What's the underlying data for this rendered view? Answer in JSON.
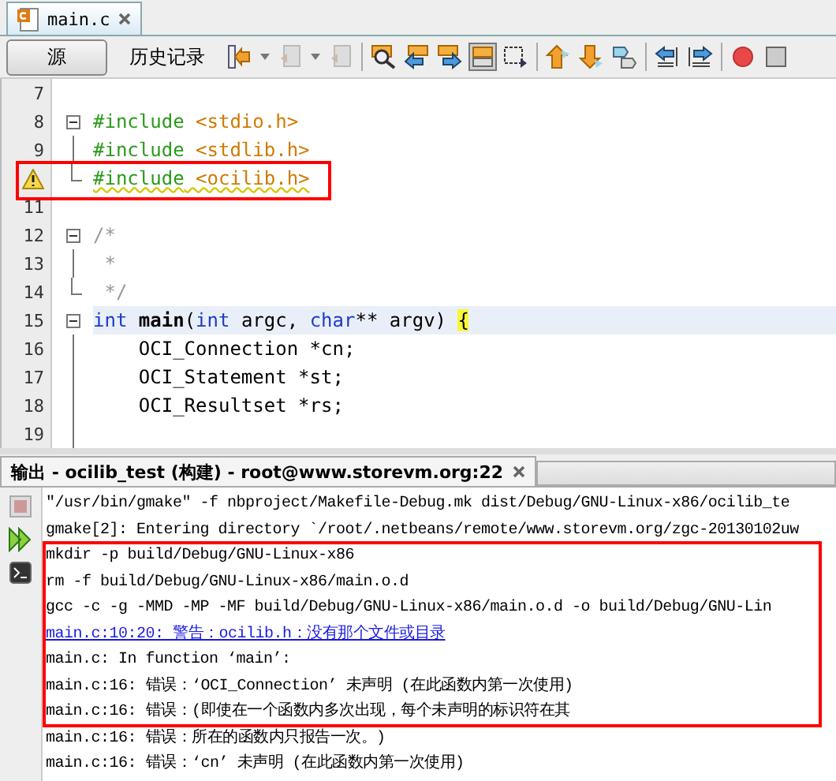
{
  "editor_tab": {
    "title": "main.c"
  },
  "view_tabs": [
    {
      "label": "源",
      "selected": true
    },
    {
      "label": "历史记录",
      "selected": false
    }
  ],
  "code_lines": [
    {
      "number": "7",
      "kind": "plain",
      "current": false
    },
    {
      "number": "8",
      "kind": "start",
      "current": false,
      "tokens": [
        {
          "kind": "directive",
          "text": "#include"
        },
        {
          "kind": "header",
          "text": " <stdio.h>"
        }
      ]
    },
    {
      "number": "9",
      "kind": "inside",
      "current": false,
      "tokens": [
        {
          "kind": "directive",
          "text": "#include"
        },
        {
          "kind": "header",
          "text": " <stdlib.h>"
        }
      ]
    },
    {
      "warning": true,
      "kind": "end",
      "current": false,
      "tokens": [
        {
          "kind": "directive",
          "text": "#include",
          "squiggle": true
        },
        {
          "kind": "header",
          "text": " <ocilib.h>",
          "squiggle": true
        }
      ]
    },
    {
      "number": "11",
      "kind": "plain",
      "current": false
    },
    {
      "number": "12",
      "kind": "start",
      "current": false,
      "tokens": [
        {
          "kind": "comment",
          "text": "/*"
        }
      ]
    },
    {
      "number": "13",
      "kind": "inside",
      "current": false,
      "tokens": [
        {
          "kind": "comment",
          "text": " *"
        }
      ]
    },
    {
      "number": "14",
      "kind": "end",
      "current": false,
      "tokens": [
        {
          "kind": "comment",
          "text": " */"
        }
      ]
    },
    {
      "number": "15",
      "kind": "start",
      "current": true,
      "tokens": [
        {
          "kind": "keyword",
          "text": "int"
        },
        {
          "kind": "function",
          "text": " main"
        },
        {
          "kind": "plain",
          "text": "("
        },
        {
          "kind": "keyword",
          "text": "int"
        },
        {
          "kind": "plain",
          "text": " argc, "
        },
        {
          "kind": "keyword",
          "text": "char"
        },
        {
          "kind": "plain",
          "text": "** argv) "
        },
        {
          "kind": "brace",
          "text": "{"
        }
      ]
    },
    {
      "number": "16",
      "kind": "inside",
      "current": false,
      "tokens": [
        {
          "kind": "plain",
          "text": "    OCI_Connection *cn;"
        }
      ]
    },
    {
      "number": "17",
      "kind": "inside",
      "current": false,
      "tokens": [
        {
          "kind": "plain",
          "text": "    OCI_Statement *st;"
        }
      ]
    },
    {
      "number": "18",
      "kind": "inside",
      "current": false,
      "tokens": [
        {
          "kind": "plain",
          "text": "    OCI_Resultset *rs;"
        }
      ]
    },
    {
      "number": "19",
      "kind": "inside",
      "current": false
    }
  ],
  "output_panel": {
    "title": "输出 - ocilib_test (构建) - root@www.storevm.org:22",
    "lines": [
      {
        "kind": "text",
        "text": "\"/usr/bin/gmake\"  -f nbproject/Makefile-Debug.mk dist/Debug/GNU-Linux-x86/ocilib_te"
      },
      {
        "kind": "text",
        "text": "gmake[2]: Entering directory `/root/.netbeans/remote/www.storevm.org/zgc-20130102uw"
      },
      {
        "kind": "text",
        "text": "mkdir -p build/Debug/GNU-Linux-x86"
      },
      {
        "kind": "text",
        "text": "rm -f build/Debug/GNU-Linux-x86/main.o.d"
      },
      {
        "kind": "text",
        "text": "gcc    -c -g -MMD -MP -MF build/Debug/GNU-Linux-x86/main.o.d -o build/Debug/GNU-Lin"
      },
      {
        "kind": "link",
        "text": "main.c:10:20: 警告：ocilib.h：没有那个文件或目录"
      },
      {
        "kind": "text",
        "text": "main.c: In function ‘main’:"
      },
      {
        "kind": "text",
        "text": "main.c:16: 错误：‘OCI_Connection’ 未声明 (在此函数内第一次使用)"
      },
      {
        "kind": "text",
        "text": "main.c:16: 错误：(即使在一个函数内多次出现，每个未声明的标识符在其"
      },
      {
        "kind": "text",
        "text": "main.c:16: 错误：所在的函数内只报告一次。)"
      },
      {
        "kind": "text",
        "text": "main.c:16: 错误：‘cn’ 未声明 (在此函数内第一次使用)"
      }
    ]
  }
}
